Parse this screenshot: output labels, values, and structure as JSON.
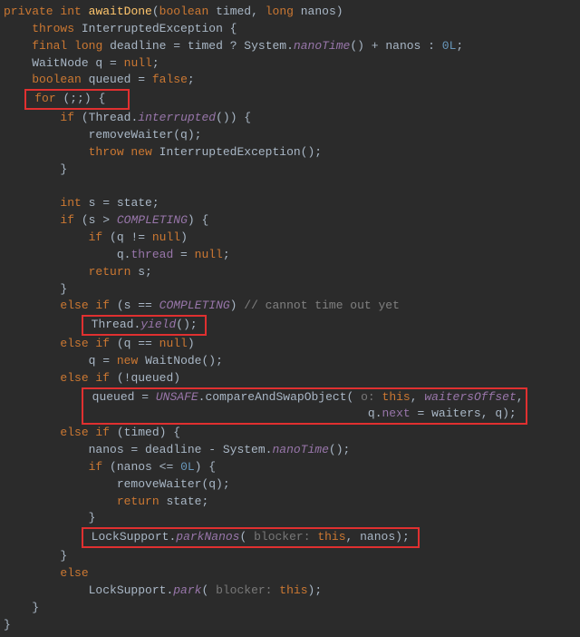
{
  "code": {
    "l01a": "private",
    "l01b": "int",
    "l01c": "awaitDone",
    "l01d": "boolean",
    "l01e": "timed",
    "l01f": "long",
    "l01g": "nanos",
    "l02a": "throws",
    "l02b": "InterruptedException {",
    "l03a": "final",
    "l03b": "long",
    "l03c": "deadline = timed ? System.",
    "l03d": "nanoTime",
    "l03e": "() + nanos : ",
    "l03f": "0L",
    "l03g": ";",
    "l04a": "WaitNode q = ",
    "l04b": "null",
    "l04c": ";",
    "l05a": "boolean",
    "l05b": "queued = ",
    "l05c": "false",
    "l05d": ";",
    "l06a": "for",
    "l06b": "(;;) {",
    "l07a": "if",
    "l07b": "(Thread.",
    "l07c": "interrupted",
    "l07d": "()) {",
    "l08a": "removeWaiter(q);",
    "l09a": "throw new",
    "l09b": "InterruptedException();",
    "l10a": "}",
    "l12a": "int",
    "l12b": "s = state;",
    "l13a": "if",
    "l13b": "(s > ",
    "l13c": "COMPLETING",
    "l13d": ") {",
    "l14a": "if",
    "l14b": "(q != ",
    "l14c": "null",
    "l14d": ")",
    "l15a": "q.",
    "l15b": "thread",
    "l15c": " = ",
    "l15d": "null",
    "l15e": ";",
    "l16a": "return",
    "l16b": "s;",
    "l17a": "}",
    "l18a": "else if",
    "l18b": "(s == ",
    "l18c": "COMPLETING",
    "l18d": ") ",
    "l18e": "// cannot time out yet",
    "l19a": "Thread.",
    "l19b": "yield",
    "l19c": "();",
    "l20a": "else if",
    "l20b": "(q == ",
    "l20c": "null",
    "l20d": ")",
    "l21a": "q = ",
    "l21b": "new",
    "l21c": "WaitNode();",
    "l22a": "else if",
    "l22b": "(!queued)",
    "l23a": "queued = ",
    "l23b": "UNSAFE",
    "l23c": ".compareAndSwapObject( ",
    "l23d": "o: ",
    "l23e": "this",
    "l23f": ", ",
    "l23g": "waitersOffset",
    "l23h": ",",
    "l24a": "q.",
    "l24b": "next",
    "l24c": " = waiters, q);",
    "l25a": "else if",
    "l25b": "(timed) {",
    "l26a": "nanos = deadline - System.",
    "l26b": "nanoTime",
    "l26c": "();",
    "l27a": "if",
    "l27b": "(nanos <= ",
    "l27c": "0L",
    "l27d": ") {",
    "l28a": "removeWaiter(q);",
    "l29a": "return",
    "l29b": "state;",
    "l30a": "}",
    "l31a": "LockSupport.",
    "l31b": "parkNanos",
    "l31c": "( ",
    "l31d": "blocker: ",
    "l31e": "this",
    "l31f": ", nanos);",
    "l32a": "}",
    "l33a": "else",
    "l34a": "LockSupport.",
    "l34b": "park",
    "l34c": "( ",
    "l34d": "blocker: ",
    "l34e": "this",
    "l34f": ");",
    "l35a": "}",
    "l36a": "}"
  }
}
